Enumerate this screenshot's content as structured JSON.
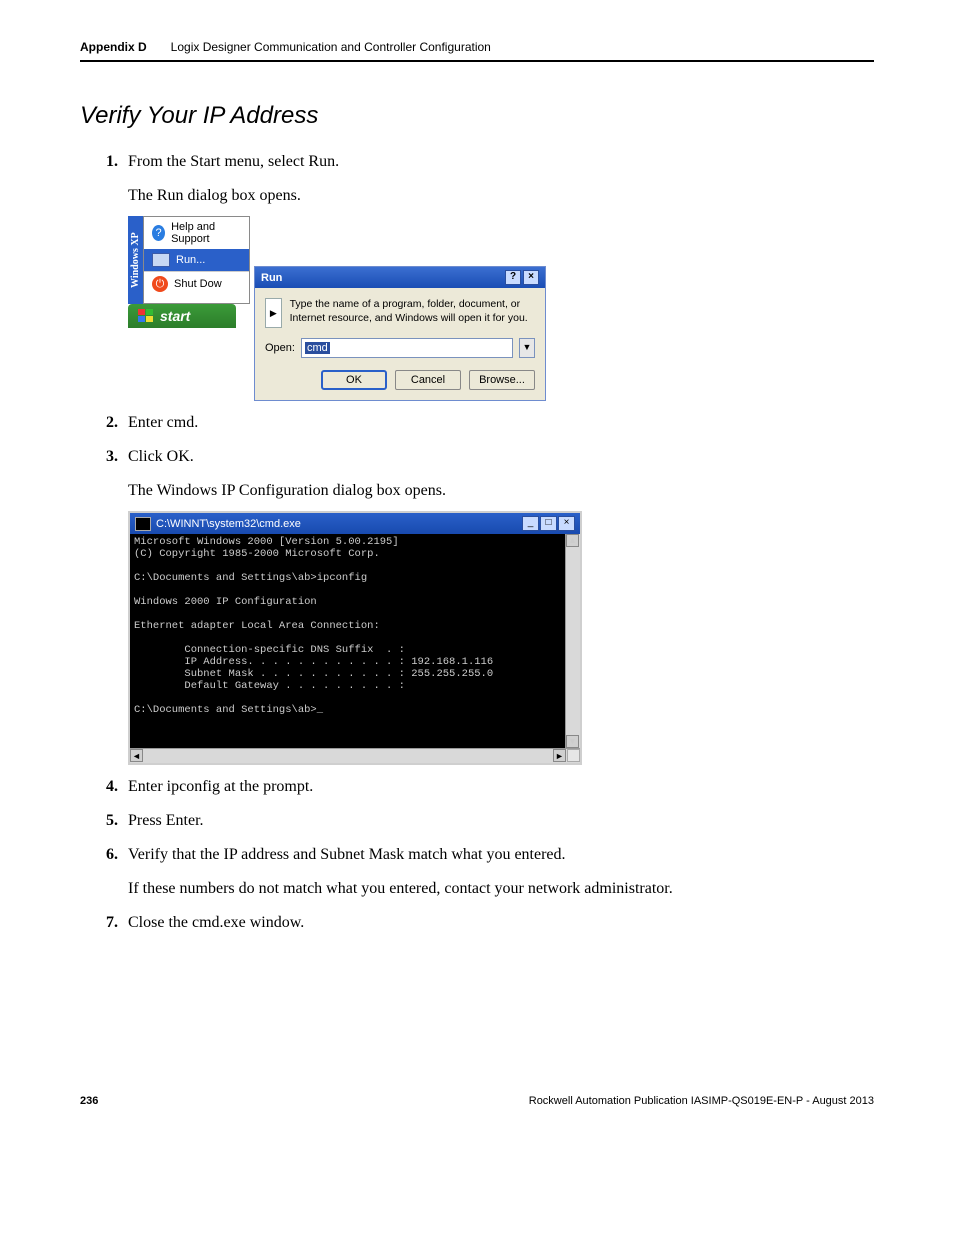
{
  "header": {
    "appendix": "Appendix D",
    "title": "Logix Designer Communication and Controller Configuration"
  },
  "section_title": "Verify Your IP Address",
  "steps": {
    "s1": {
      "num": "1.",
      "text": "From the Start menu, select Run."
    },
    "s1_sub": "The Run dialog box opens.",
    "s2": {
      "num": "2.",
      "text": "Enter cmd."
    },
    "s3": {
      "num": "3.",
      "text": "Click OK."
    },
    "s3_sub": "The Windows IP Configuration dialog box opens.",
    "s4": {
      "num": "4.",
      "text": "Enter ipconfig at the prompt."
    },
    "s5": {
      "num": "5.",
      "text": "Press Enter."
    },
    "s6": {
      "num": "6.",
      "text": "Verify that the IP address and Subnet Mask match what you entered."
    },
    "s6_sub": "If these numbers do not match what you entered, contact your network administrator.",
    "s7": {
      "num": "7.",
      "text": "Close the cmd.exe window."
    }
  },
  "startmenu": {
    "brand": "Windows XP",
    "help": "Help and Support",
    "run": "Run...",
    "shutdown": "Shut Dow",
    "start": "start"
  },
  "run_dialog": {
    "title": "Run",
    "help_btn": "?",
    "close_btn": "×",
    "desc": "Type the name of a program, folder, document, or Internet resource, and Windows will open it for you.",
    "open_label": "Open:",
    "open_value": "cmd",
    "ok": "OK",
    "cancel": "Cancel",
    "browse": "Browse..."
  },
  "cmd": {
    "title": "C:\\WINNT\\system32\\cmd.exe",
    "min": "_",
    "max": "□",
    "close": "×",
    "body": "Microsoft Windows 2000 [Version 5.00.2195]\n(C) Copyright 1985-2000 Microsoft Corp.\n\nC:\\Documents and Settings\\ab>ipconfig\n\nWindows 2000 IP Configuration\n\nEthernet adapter Local Area Connection:\n\n        Connection-specific DNS Suffix  . :\n        IP Address. . . . . . . . . . . . : 192.168.1.116\n        Subnet Mask . . . . . . . . . . . : 255.255.255.0\n        Default Gateway . . . . . . . . . :\n\nC:\\Documents and Settings\\ab>_"
  },
  "footer": {
    "page": "236",
    "pub": "Rockwell Automation Publication IASIMP-QS019E-EN-P - August 2013"
  }
}
